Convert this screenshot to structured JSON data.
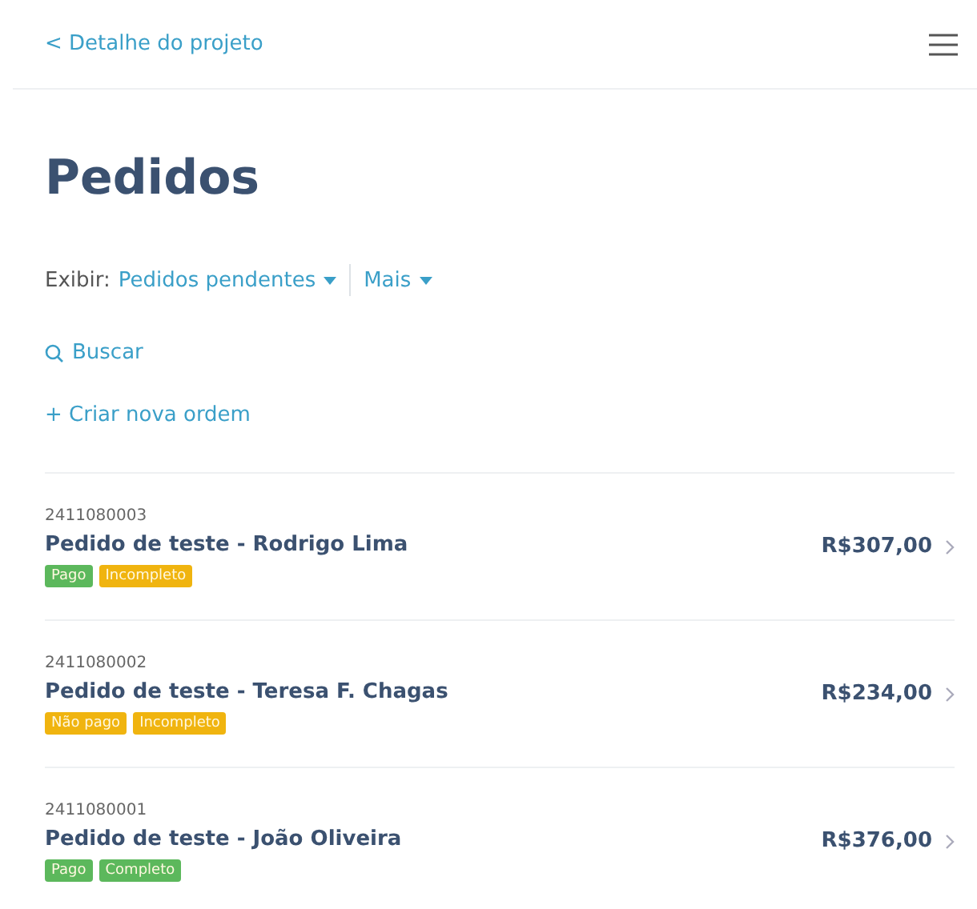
{
  "header": {
    "back_link": "< Detalhe do projeto"
  },
  "title": "Pedidos",
  "filter": {
    "label": "Exibir:",
    "view": "Pedidos pendentes",
    "more": "Mais"
  },
  "search": {
    "label": "Buscar"
  },
  "create": {
    "label": "+ Criar nova ordem"
  },
  "orders": [
    {
      "id": "2411080003",
      "title": "Pedido de teste - Rodrigo Lima",
      "amount": "R$307,00",
      "tags": [
        {
          "label": "Pago",
          "color": "#5cb85c"
        },
        {
          "label": "Incompleto",
          "color": "#f0b40f"
        }
      ]
    },
    {
      "id": "2411080002",
      "title": "Pedido de teste - Teresa F. Chagas",
      "amount": "R$234,00",
      "tags": [
        {
          "label": "Não pago",
          "color": "#f0b40f"
        },
        {
          "label": "Incompleto",
          "color": "#f0b40f"
        }
      ]
    },
    {
      "id": "2411080001",
      "title": "Pedido de teste - João Oliveira",
      "amount": "R$376,00",
      "tags": [
        {
          "label": "Pago",
          "color": "#5cb85c"
        },
        {
          "label": "Completo",
          "color": "#5cb85c"
        }
      ]
    }
  ]
}
